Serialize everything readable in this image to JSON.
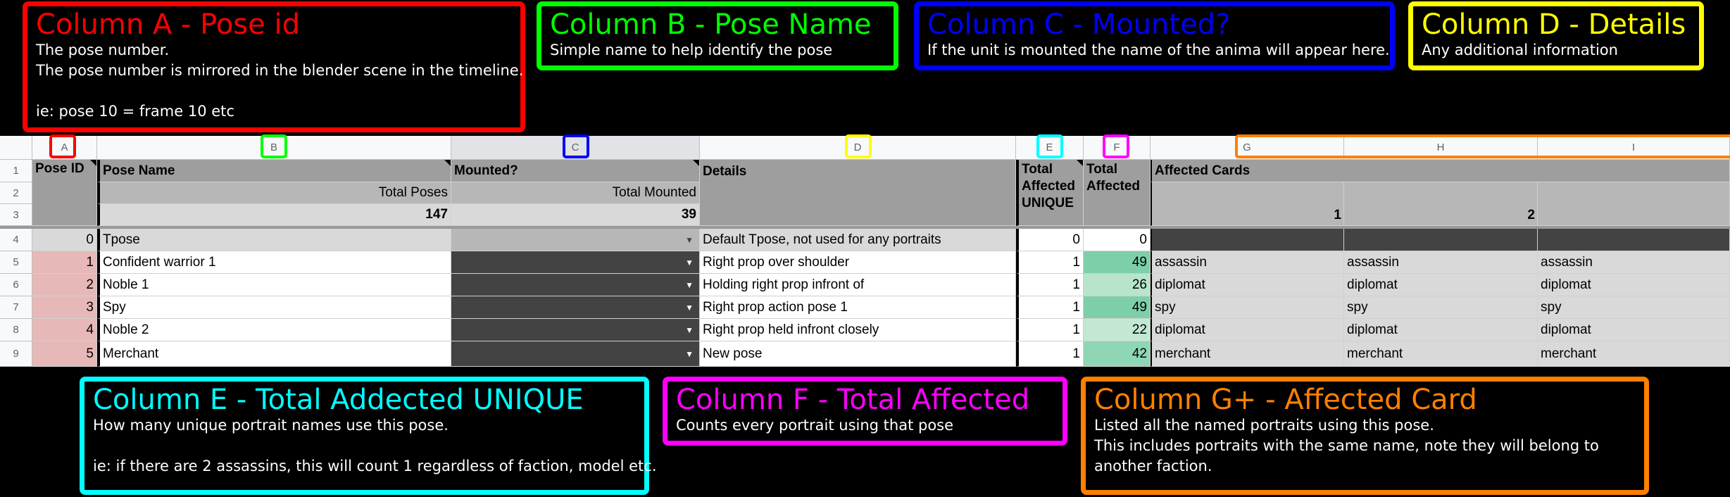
{
  "callouts": {
    "col_a": {
      "title": "Column A - Pose id",
      "lines": [
        "The pose number.",
        "The pose number is mirrored in the blender scene in the timeline.",
        "",
        "ie: pose 10 = frame 10 etc"
      ],
      "color": "#ff0000"
    },
    "col_b": {
      "title": "Column B - Pose Name",
      "lines": [
        "Simple name to help identify the pose"
      ],
      "color": "#00ff00"
    },
    "col_c": {
      "title": "Column C - Mounted?",
      "lines": [
        "If the unit is mounted the name of the anima will appear here."
      ],
      "color": "#0000ff"
    },
    "col_d": {
      "title": "Column D - Details",
      "lines": [
        "Any additional information"
      ],
      "color": "#ffff00"
    },
    "col_e": {
      "title": "Column E - Total Addected UNIQUE",
      "lines": [
        "How many unique portrait names use this pose.",
        "",
        "ie: if there are 2 assassins, this will count 1 regardless of faction, model etc."
      ],
      "color": "#00ffff"
    },
    "col_f": {
      "title": "Column F - Total Affected",
      "lines": [
        "Counts every portrait using that pose"
      ],
      "color": "#ff00ff"
    },
    "col_g": {
      "title": "Column G+ - Affected Card",
      "lines": [
        "Listed all the named portraits using this pose.",
        "This includes portraits with the same name, note they will belong to",
        "another faction."
      ],
      "color": "#ff8000"
    }
  },
  "spreadsheet": {
    "column_letters": [
      "A",
      "B",
      "C",
      "D",
      "E",
      "F",
      "G",
      "H",
      "I"
    ],
    "row_numbers": [
      "1",
      "2",
      "3",
      "4",
      "5",
      "6",
      "7",
      "8",
      "9"
    ],
    "header": {
      "pose_id": "Pose ID",
      "pose_name": "Pose Name",
      "mounted": "Mounted?",
      "details": "Details",
      "total_affected_unique": "Total Affected UNIQUE",
      "total_affected": "Total Affected",
      "affected_cards": "Affected Cards",
      "total_poses_label": "Total Poses",
      "total_poses_value": "147",
      "total_mounted_label": "Total Mounted",
      "total_mounted_value": "39",
      "card_index_1": "1",
      "card_index_2": "2"
    },
    "rows": [
      {
        "id": "0",
        "name": "Tpose",
        "mounted": "",
        "details": "Default Tpose, not used for any portraits",
        "unique": "0",
        "total": "0",
        "cards": [
          "",
          "",
          ""
        ]
      },
      {
        "id": "1",
        "name": "Confident warrior 1",
        "mounted": "",
        "details": "Right prop over shoulder",
        "unique": "1",
        "total": "49",
        "cards": [
          "assassin",
          "assassin",
          "assassin"
        ]
      },
      {
        "id": "2",
        "name": "Noble 1",
        "mounted": "",
        "details": "Holding right prop infront of",
        "unique": "1",
        "total": "26",
        "cards": [
          "diplomat",
          "diplomat",
          "diplomat"
        ]
      },
      {
        "id": "3",
        "name": "Spy",
        "mounted": "",
        "details": "Right prop action pose 1",
        "unique": "1",
        "total": "49",
        "cards": [
          "spy",
          "spy",
          "spy"
        ]
      },
      {
        "id": "4",
        "name": "Noble 2",
        "mounted": "",
        "details": "Right prop held infront closely",
        "unique": "1",
        "total": "22",
        "cards": [
          "diplomat",
          "diplomat",
          "diplomat"
        ]
      },
      {
        "id": "5",
        "name": "Merchant",
        "mounted": "",
        "details": "New pose",
        "unique": "1",
        "total": "42",
        "cards": [
          "merchant",
          "merchant",
          "merchant"
        ]
      }
    ],
    "total_affected_colors": [
      "#ffffff",
      "#7dcfa8",
      "#b8e4cc",
      "#7dcfa8",
      "#c2e8d3",
      "#8fd6b4"
    ]
  }
}
